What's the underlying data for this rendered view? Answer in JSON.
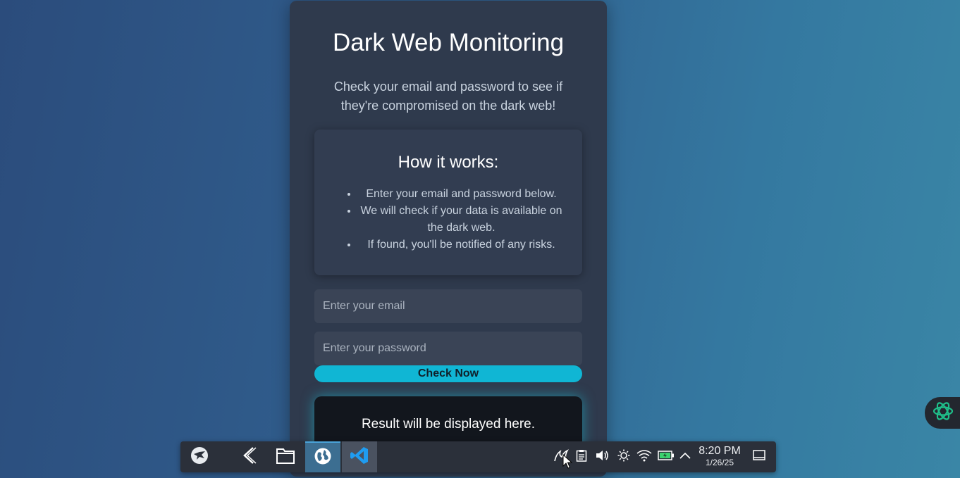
{
  "card": {
    "title": "Dark Web Monitoring",
    "subtitle": "Check your email and password to see if they're compromised on the dark web!"
  },
  "how_it_works": {
    "title": "How it works:",
    "items": [
      "Enter your email and password below.",
      "We will check if your data is available on the dark web.",
      "If found, you'll be notified of any risks."
    ]
  },
  "form": {
    "email_placeholder": "Enter your email",
    "email_value": "",
    "password_placeholder": "Enter your password",
    "password_value": "",
    "check_button_label": "Check Now"
  },
  "result": {
    "text": "Result will be displayed here."
  },
  "taskbar": {
    "apps": [
      {
        "icon": "app-launcher-icon",
        "state": "normal"
      },
      {
        "icon": "kali-menu-icon",
        "state": "normal"
      },
      {
        "icon": "file-manager-icon",
        "state": "normal"
      },
      {
        "icon": "web-browser-icon",
        "state": "active"
      },
      {
        "icon": "vscode-icon",
        "state": "running"
      }
    ],
    "tray_icons": [
      "kali-dragon-icon",
      "clipboard-icon",
      "volume-icon",
      "brightness-icon",
      "wifi-icon",
      "battery-icon",
      "show-hidden-chevron-icon",
      "show-desktop-icon"
    ],
    "clock_time": "8:20 PM",
    "clock_date": "1/26/25"
  },
  "colors": {
    "accent": "#10b6d4",
    "card_bg": "#2f3a4d",
    "result_glow": "#18c8dc",
    "chat_icon": "#1fbf8a"
  },
  "side_widget": {
    "icon": "chat-assistant-icon"
  }
}
